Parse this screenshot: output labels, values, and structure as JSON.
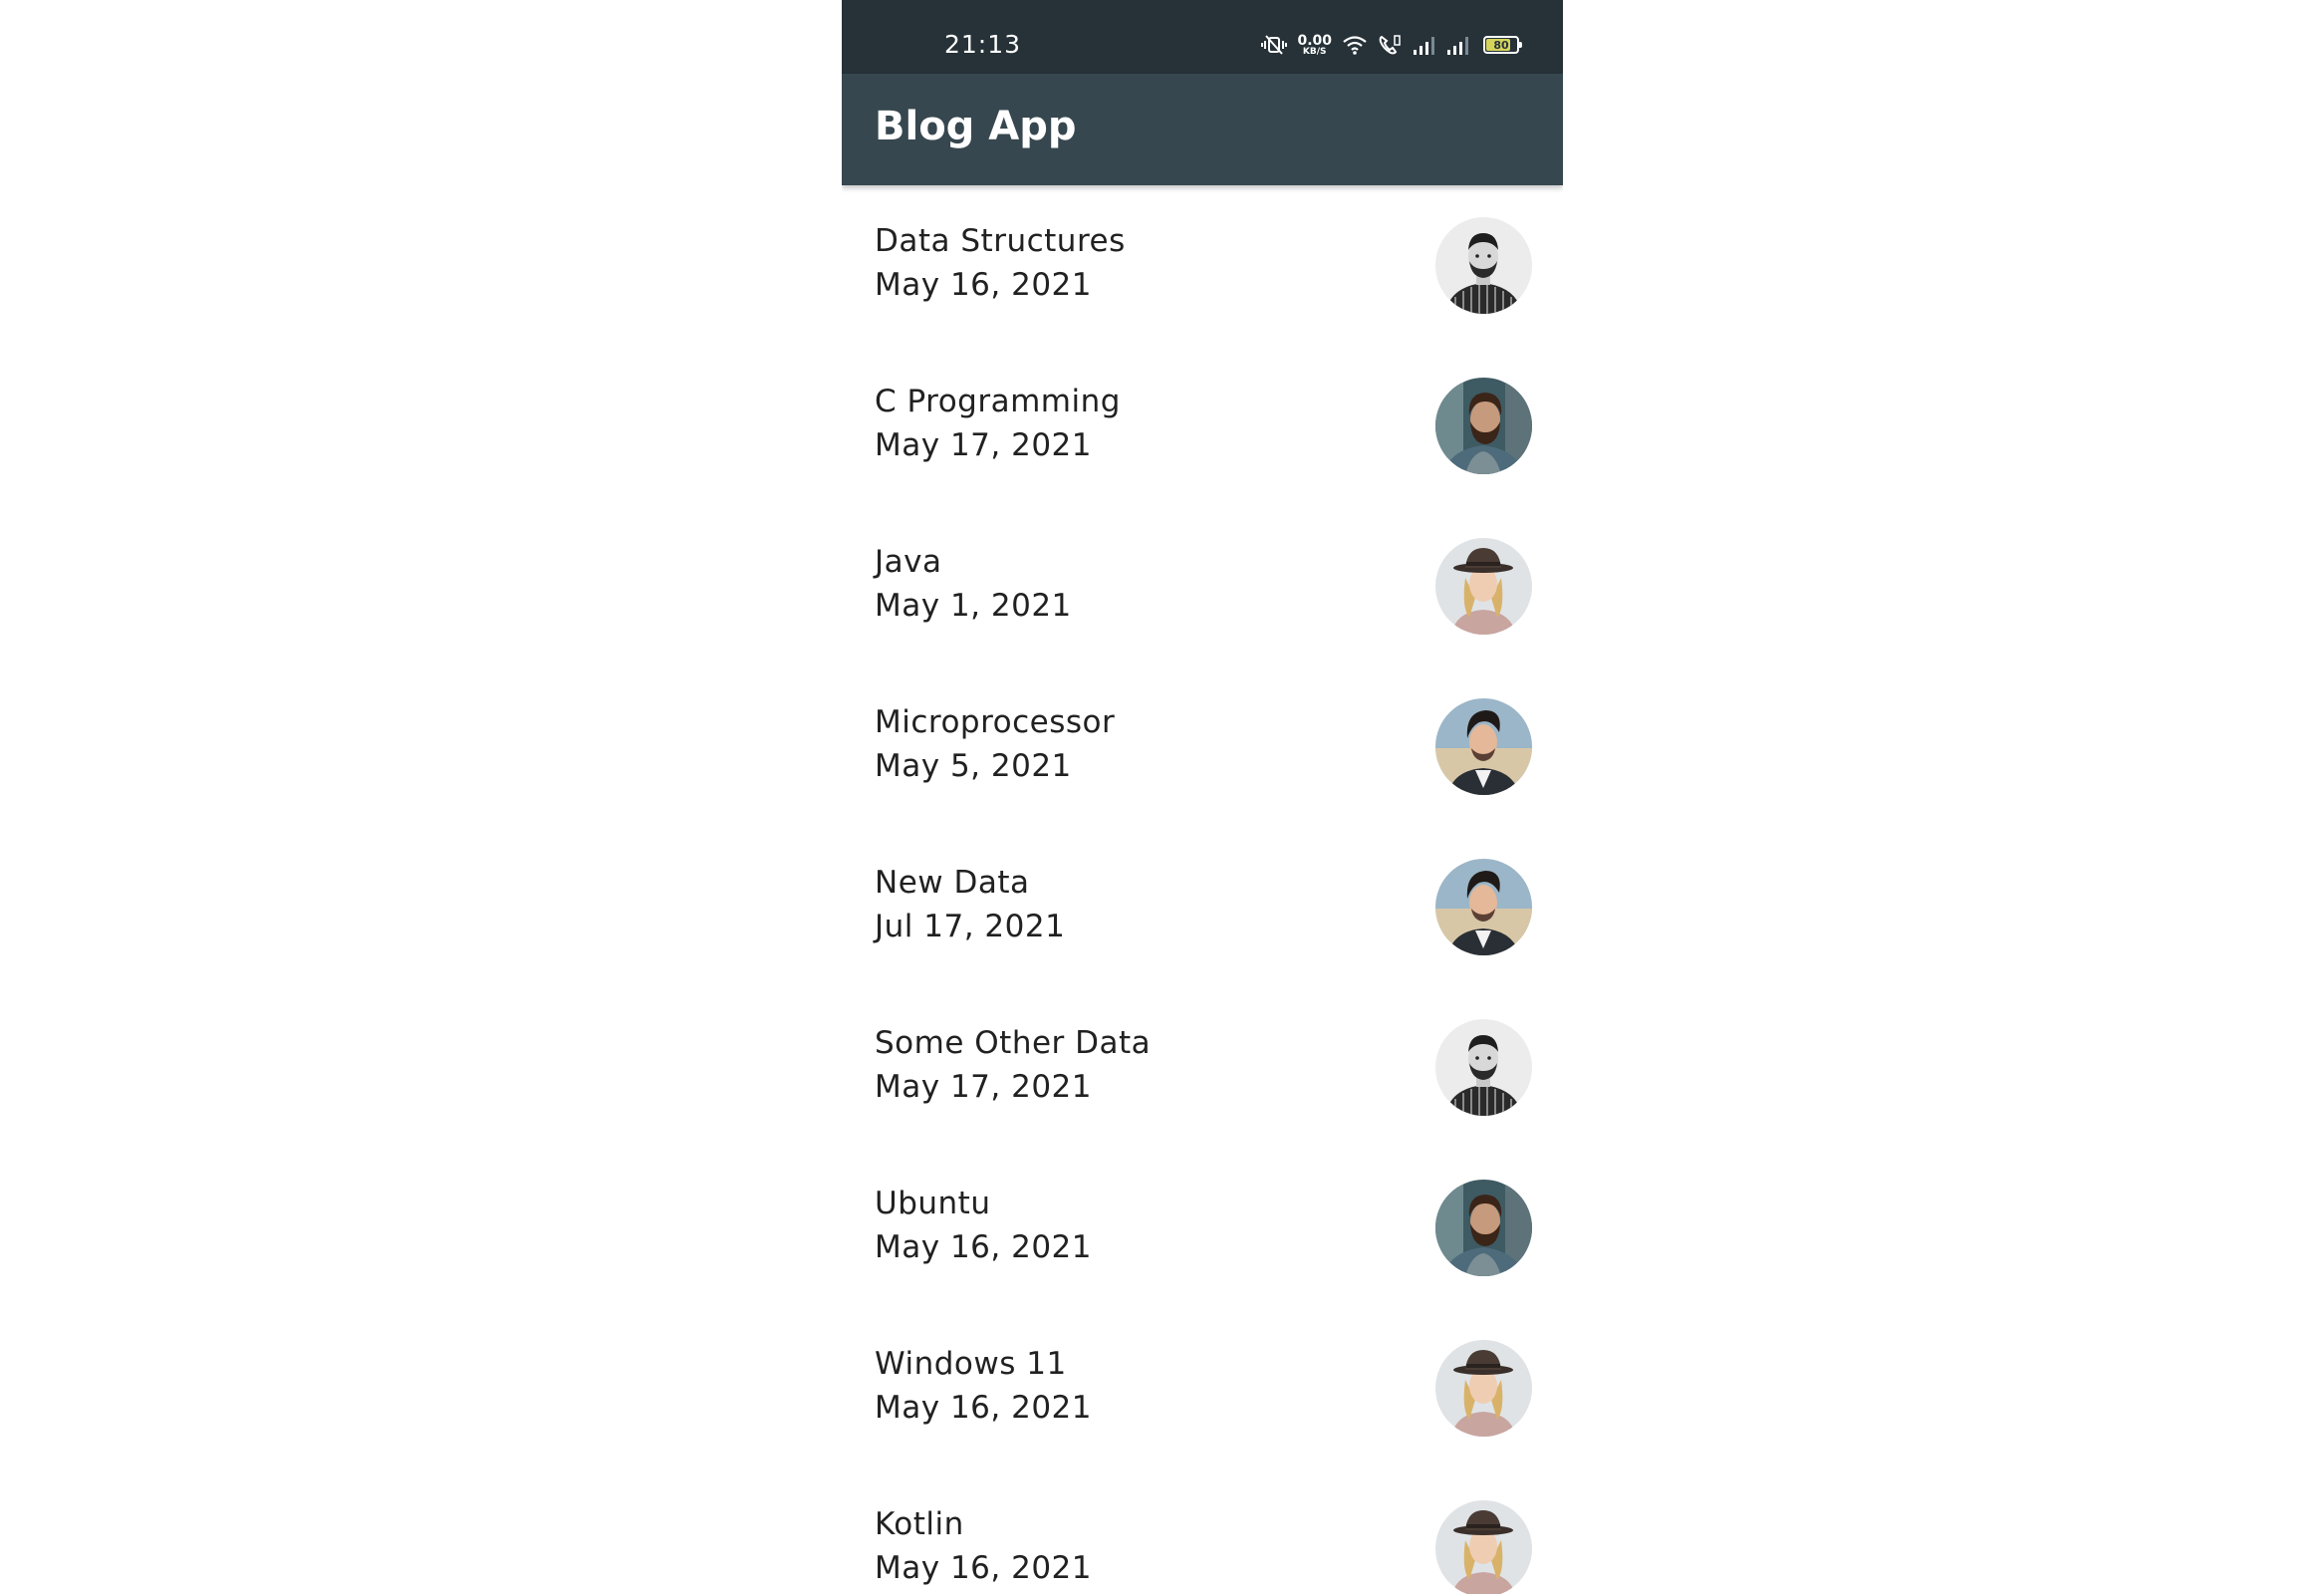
{
  "status_bar": {
    "time": "21:13",
    "net_speed_value": "0.00",
    "net_speed_unit": "KB/S",
    "battery_level": "80",
    "icons": [
      "mute-vibrate-icon",
      "wifi-icon",
      "volte-call-icon",
      "signal-icon",
      "signal-icon",
      "battery-icon"
    ]
  },
  "app_bar": {
    "title": "Blog App"
  },
  "colors": {
    "status_bar": "#263238",
    "app_bar": "#37474f",
    "text": "#212121"
  },
  "posts": [
    {
      "title": "Data Structures",
      "date": "May 16, 2021",
      "avatar": "bw-bearded-man"
    },
    {
      "title": "C Programming",
      "date": "May 17, 2021",
      "avatar": "bearded-man-color"
    },
    {
      "title": "Java",
      "date": "May 1, 2021",
      "avatar": "woman-with-hat"
    },
    {
      "title": "Microprocessor",
      "date": "May 5, 2021",
      "avatar": "man-styled-hair"
    },
    {
      "title": "New Data",
      "date": "Jul 17, 2021",
      "avatar": "man-styled-hair"
    },
    {
      "title": "Some Other Data",
      "date": "May 17, 2021",
      "avatar": "bw-bearded-man"
    },
    {
      "title": "Ubuntu",
      "date": "May 16, 2021",
      "avatar": "bearded-man-color"
    },
    {
      "title": "Windows 11",
      "date": "May 16, 2021",
      "avatar": "woman-with-hat"
    },
    {
      "title": "Kotlin",
      "date": "May 16, 2021",
      "avatar": "woman-with-hat"
    }
  ]
}
